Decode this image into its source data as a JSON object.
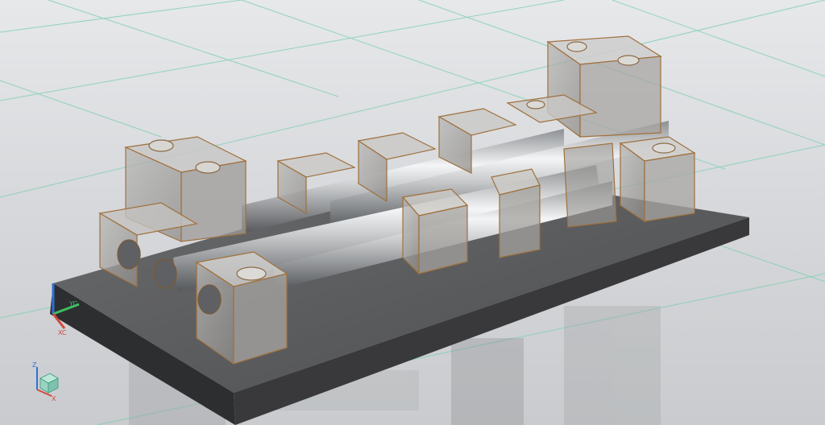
{
  "viewport": {
    "background_top": "#e6e8ea",
    "background_bottom": "#c9cbce",
    "grid_color": "#7ecfb0",
    "edge_color": "#a0703c",
    "base_plate_color": "#5a5b5d"
  },
  "model_triad": {
    "x_label": "XC",
    "y_label": "YC",
    "x_color": "#d24a3c",
    "y_color": "#3cbf63",
    "z_color": "#2f6fd6"
  },
  "view_triad": {
    "x_label": "X",
    "z_label": "Z",
    "icon": "view-cube-icon"
  }
}
